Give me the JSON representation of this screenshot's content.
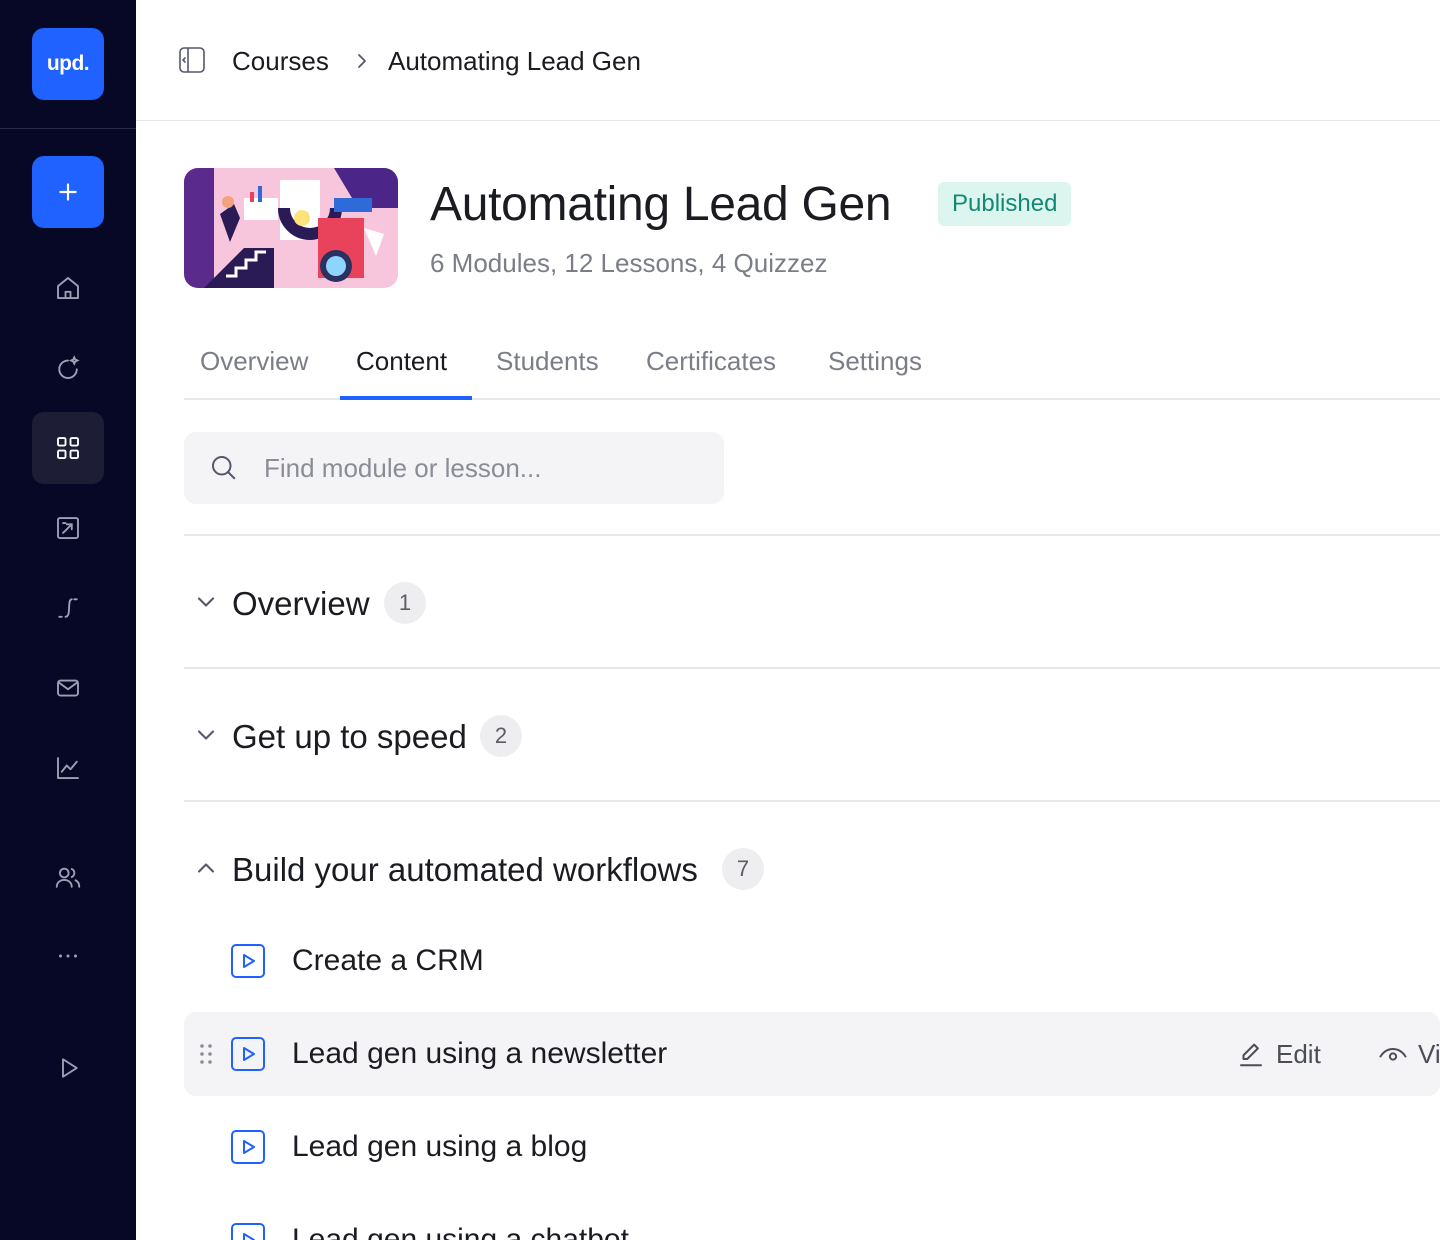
{
  "sidebar": {
    "logo_text": "upd.",
    "nav_items": [
      {
        "icon": "home-icon"
      },
      {
        "icon": "sparkle-refresh-icon"
      },
      {
        "icon": "grid-icon",
        "active": true
      },
      {
        "icon": "presentation-icon"
      },
      {
        "icon": "route-icon"
      },
      {
        "icon": "mail-icon"
      },
      {
        "icon": "chart-icon"
      },
      {
        "icon": "users-icon"
      },
      {
        "icon": "more-icon"
      },
      {
        "icon": "play-icon"
      }
    ]
  },
  "breadcrumb": {
    "root": "Courses",
    "current": "Automating Lead Gen"
  },
  "course": {
    "title": "Automating Lead Gen",
    "status": "Published",
    "meta": "6 Modules, 12 Lessons, 4 Quizzez"
  },
  "tabs": [
    "Overview",
    "Content",
    "Students",
    "Certificates",
    "Settings"
  ],
  "active_tab": "Content",
  "search": {
    "placeholder": "Find module or lesson..."
  },
  "modules": [
    {
      "title": "Overview",
      "count": "1",
      "expanded": false
    },
    {
      "title": "Get up to speed",
      "count": "2",
      "expanded": false
    },
    {
      "title": "Build your automated workflows",
      "count": "7",
      "expanded": true
    }
  ],
  "lessons": [
    {
      "title": "Create a CRM"
    },
    {
      "title": "Lead gen using a newsletter"
    },
    {
      "title": "Lead gen using a blog"
    },
    {
      "title": "Lead gen using a chatbot"
    }
  ],
  "lesson_actions": {
    "edit_label": "Edit",
    "view_label": "View"
  },
  "colors": {
    "accent": "#1f62ff",
    "sidebar_bg": "#070826",
    "badge_bg": "#ddf5ef",
    "badge_text": "#118a74"
  }
}
